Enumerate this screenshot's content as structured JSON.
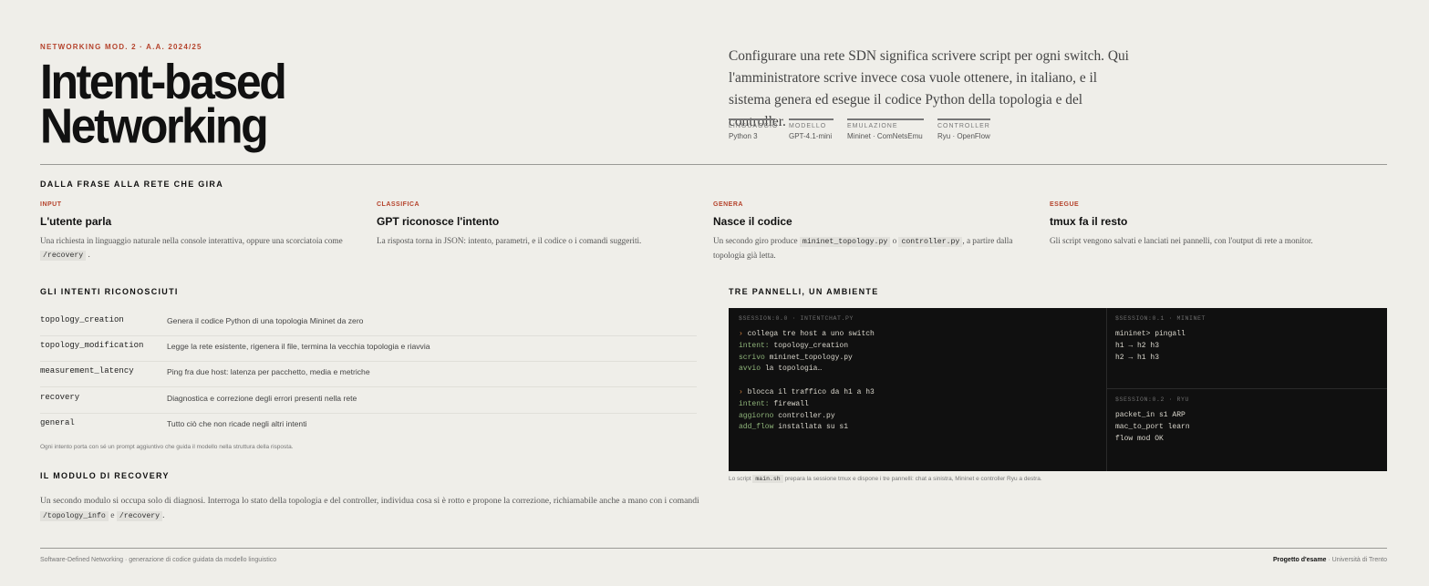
{
  "header": {
    "kicker": "NETWORKING MOD. 2 · A.A. 2024/25",
    "title_line1": "Intent-based",
    "title_line2": "Networking",
    "lead": "Configurare una rete SDN significa scrivere script per ogni switch. Qui l'amministratore scrive invece cosa vuole ottenere, in italiano, e il sistema genera ed esegue il codice Python della topologia e del controller."
  },
  "meta": [
    {
      "key": "LINGUAGGIO",
      "value": "Python 3"
    },
    {
      "key": "MODELLO",
      "value": "GPT-4.1-mini"
    },
    {
      "key": "EMULAZIONE",
      "value": "Mininet · ComNetsEmu"
    },
    {
      "key": "CONTROLLER",
      "value": "Ryu · OpenFlow"
    }
  ],
  "flow": {
    "title": "DALLA FRASE ALLA RETE CHE GIRA",
    "steps": [
      {
        "label": "INPUT",
        "heading": "L'utente parla",
        "desc_a": "Una richiesta in linguaggio naturale nella console interattiva, oppure una scorciatoia come",
        "code1": "/recovery",
        "desc_b": "."
      },
      {
        "label": "CLASSIFICA",
        "heading": "GPT riconosce l'intento",
        "desc_a": "La risposta torna in JSON: intento, parametri, e il codice o i comandi suggeriti."
      },
      {
        "label": "GENERA",
        "heading": "Nasce il codice",
        "desc_a": "Un secondo giro produce",
        "code1": "mininet_topology.py",
        "desc_mid": "o",
        "code2": "controller.py",
        "desc_b": ", a partire dalla topologia già letta."
      },
      {
        "label": "ESEGUE",
        "heading": "tmux fa il resto",
        "desc_a": "Gli script vengono salvati e lanciati nei pannelli, con l'output di rete a monitor."
      }
    ]
  },
  "intents": {
    "title": "GLI INTENTI RICONOSCIUTI",
    "rows": [
      {
        "name": "topology_creation",
        "desc": "Genera il codice Python di una topologia Mininet da zero"
      },
      {
        "name": "topology_modification",
        "desc": "Legge la rete esistente, rigenera il file, termina la vecchia topologia e riavvia"
      },
      {
        "name": "measurement_latency",
        "desc": "Ping fra due host: latenza per pacchetto, media e metriche"
      },
      {
        "name": "recovery",
        "desc": "Diagnostica e correzione degli errori presenti nella rete"
      },
      {
        "name": "general",
        "desc": "Tutto ciò che non ricade negli altri intenti"
      }
    ],
    "note": "Ogni intento porta con sé un prompt aggiuntivo che guida il modello nella struttura della risposta."
  },
  "recovery": {
    "title": "IL MODULO DI RECOVERY",
    "text_a": "Un secondo modulo si occupa solo di diagnosi. Interroga lo stato della topologia e del controller, individua cosa si è rotto e propone la correzione, richiamabile anche a mano con i comandi",
    "code1": "/topology_info",
    "mid": "e",
    "code2": "/recovery",
    "text_b": "."
  },
  "panels": {
    "title": "TRE PANNELLI, UN AMBIENTE",
    "left_header": "$SESSION:0.0 · INTENTCHAT.PY",
    "left": {
      "l1_prompt": "›",
      "l1": "collega tre host a uno switch",
      "l2_key": "intent:",
      "l2": "topology_creation",
      "l3_key": "scrivo",
      "l3": "mininet_topology.py",
      "l4_key": "avvio",
      "l4": "la topologia…",
      "l5_prompt": "›",
      "l5": "blocca il traffico da h1 a h3",
      "l6_key": "intent:",
      "l6": "firewall",
      "l7_key": "aggiorno",
      "l7": "controller.py",
      "l8_key": "add_flow",
      "l8": "installata su s1"
    },
    "top_right_header": "$SESSION:0.1 · MININET",
    "top_right_lines": [
      "mininet> pingall",
      "h1 → h2 h3",
      "h2 → h1 h3"
    ],
    "bottom_right_header": "$SESSION:0.2 · RYU",
    "bottom_right_lines": [
      "packet_in s1 ARP",
      "mac_to_port learn",
      "flow mod OK"
    ],
    "caption_a": "Lo script",
    "caption_code": "main.sh",
    "caption_b": "prepara la sessione tmux e dispone i tre pannelli: chat a sinistra, Mininet e controller Ryu a destra."
  },
  "footer": {
    "left": "Software-Defined Networking · generazione di codice guidata da modello linguistico",
    "right_bold": "Progetto d'esame",
    "right": "· Università di Trento"
  },
  "colors": {
    "accent": "#b5432c",
    "background": "#efeee9",
    "terminal": "#101010",
    "terminal_green": "#8fb57a",
    "terminal_orange": "#d1803f"
  }
}
